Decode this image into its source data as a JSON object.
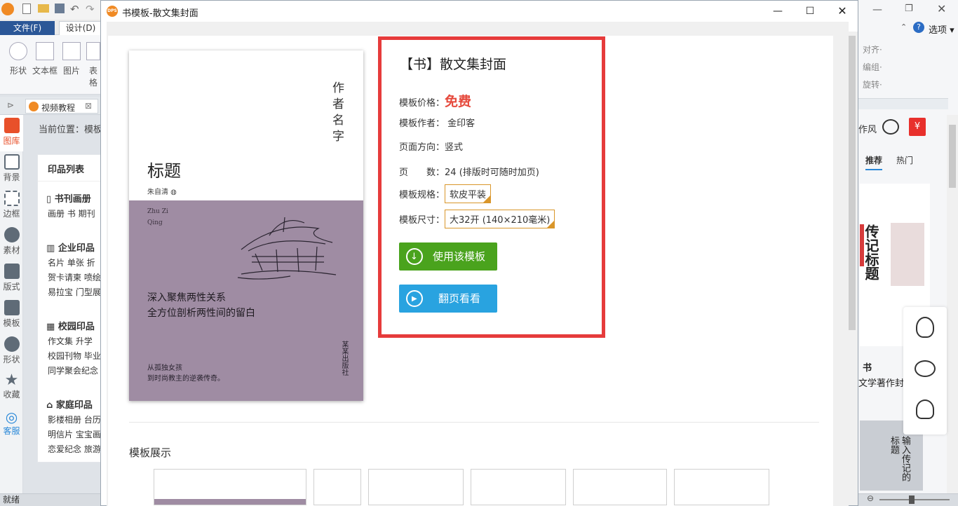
{
  "app": {
    "file_menu": "文件(F)",
    "design_tab": "设计(D)",
    "ribbon_tools": [
      "形状",
      "文本框",
      "图片",
      "表格"
    ],
    "doc_tab": "视频教程",
    "left_nav": [
      "图库",
      "背景",
      "边框",
      "素材",
      "版式",
      "模板",
      "形状",
      "收藏",
      "客服"
    ],
    "breadcrumb": "当前位置：模板",
    "product_list": {
      "title": "印品列表",
      "sections": [
        {
          "name": "书刊画册",
          "rows": [
            "画册  书  期刊"
          ]
        },
        {
          "name": "企业印品",
          "rows": [
            "名片  单张  折",
            "贺卡请柬  喷绘",
            "易拉宝  门型展"
          ]
        },
        {
          "name": "校园印品",
          "rows": [
            "作文集  升学",
            "校园刊物  毕业",
            "同学聚会纪念"
          ]
        },
        {
          "name": "家庭印品",
          "rows": [
            "影楼相册  台历",
            "明信片  宝宝画",
            "恋爱纪念  旅游"
          ]
        }
      ]
    },
    "status_text": "就绪",
    "right_pane": {
      "options": "选项",
      "align": "对齐·",
      "group": "编组·",
      "rotate": "旋转·",
      "wind_text": "作风",
      "tabs": [
        "推荐",
        "热门"
      ],
      "thumb_caption_1": "书",
      "thumb_caption_2": "文学著作封",
      "thumb_title_1": "传记标题",
      "thumb_title_2": "输入传记的标题"
    }
  },
  "dialog": {
    "title": "书模板-散文集封面",
    "cover": {
      "author": "作者名字",
      "heading": "标题",
      "subname": "朱自清",
      "pinyin": "Zhu Zi Qing",
      "slogan_line1": "深入聚焦两性关系",
      "slogan_line2": "全方位剖析两性间的留白",
      "tagline_line1": "从孤独女孩",
      "tagline_line2": "到时尚教主的逆袭传奇。",
      "publisher": "某某出版社"
    },
    "info": {
      "title": "【书】散文集封面",
      "price_label": "模板价格：",
      "price_value": "免费",
      "author_label": "模板作者：",
      "author_value": "金印客",
      "orientation_label": "页面方向：",
      "orientation_value": "竖式",
      "pages_label": "页　　数：",
      "pages_value": "24 (排版时可随时加页)",
      "spec_label": "模板规格：",
      "spec_value": "软皮平装",
      "size_label": "模板尺寸：",
      "size_value": "大32开 (140×210毫米)",
      "use_button": "使用该模板",
      "flip_button": "翻页看看"
    },
    "showcase_label": "模板展示"
  },
  "colors": {
    "accent_red": "#e63b3b",
    "use_green": "#4aa31d",
    "flip_blue": "#29a3e0",
    "cover_purple": "#9f8ca3",
    "select_border": "#d9962a"
  }
}
